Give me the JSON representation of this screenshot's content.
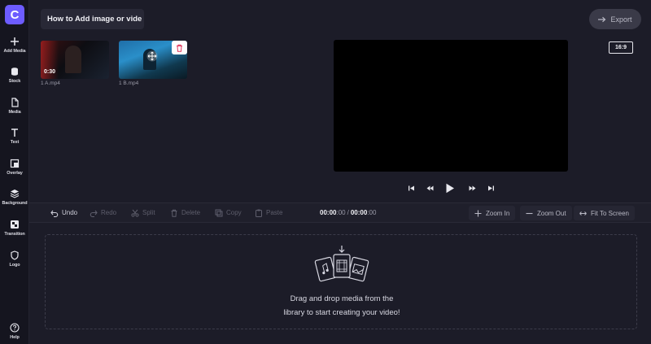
{
  "app": {
    "logo_letter": "C",
    "accent": "#6d5cff"
  },
  "sidebar": {
    "items": [
      {
        "label": "Add Media",
        "icon": "plus-icon"
      },
      {
        "label": "Stock",
        "icon": "database-icon"
      },
      {
        "label": "Media",
        "icon": "file-icon"
      },
      {
        "label": "Text",
        "icon": "text-icon"
      },
      {
        "label": "Overlay",
        "icon": "overlay-icon"
      },
      {
        "label": "Background",
        "icon": "layers-icon"
      },
      {
        "label": "Transition",
        "icon": "transition-icon"
      },
      {
        "label": "Logo",
        "icon": "shield-icon"
      },
      {
        "label": "Help",
        "icon": "help-icon"
      }
    ]
  },
  "header": {
    "project_title": "How to Add image or vide",
    "export_label": "Export"
  },
  "media": {
    "items": [
      {
        "name": "1 A.mp4",
        "duration": "0:30"
      },
      {
        "name": "1 B.mp4"
      }
    ]
  },
  "preview": {
    "aspect_ratio": "16:9"
  },
  "toolbar": {
    "undo": "Undo",
    "redo": "Redo",
    "split": "Split",
    "delete": "Delete",
    "copy": "Copy",
    "paste": "Paste",
    "time_current": "00:00",
    "time_current_frac": ":00",
    "time_separator": "/",
    "time_total": "00:00",
    "time_total_frac": ":00",
    "zoom_in": "Zoom In",
    "zoom_out": "Zoom Out",
    "fit": "Fit To Screen"
  },
  "timeline": {
    "empty_line1": "Drag and drop media from the",
    "empty_line2": "library to start creating your video!"
  }
}
